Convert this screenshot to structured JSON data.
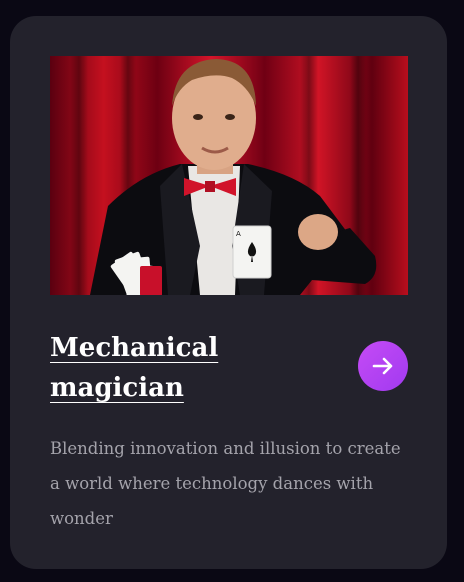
{
  "card": {
    "image": {
      "subject": "magician-photo"
    },
    "title": "Mechanical magician",
    "description": "Blending innovation and illusion to create a world where technology dances with wonder",
    "action_icon": "arrow-right-icon",
    "accent_color": "#b544f3"
  }
}
